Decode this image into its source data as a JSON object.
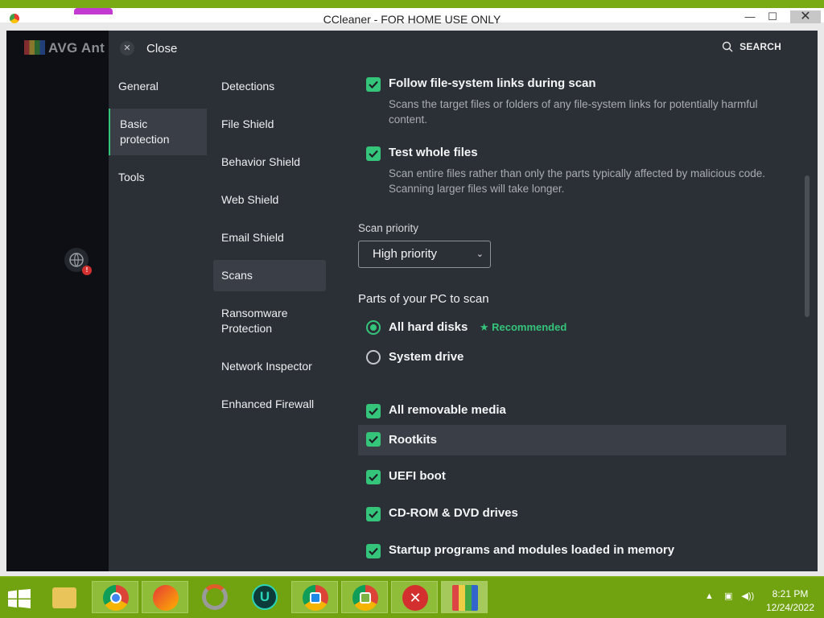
{
  "outer_window": {
    "title": "CCleaner - FOR HOME USE ONLY",
    "minimize_glyph": "—",
    "maximize_glyph": "☐",
    "close_glyph": "✕"
  },
  "avg": {
    "logo_text": "AVG Ant"
  },
  "header": {
    "close_label": "Close",
    "search_label": "SEARCH"
  },
  "nav_primary": [
    {
      "label": "General"
    },
    {
      "label": "Basic protection"
    },
    {
      "label": "Tools"
    }
  ],
  "nav_secondary": [
    {
      "label": "Detections"
    },
    {
      "label": "File Shield"
    },
    {
      "label": "Behavior Shield"
    },
    {
      "label": "Web Shield"
    },
    {
      "label": "Email Shield"
    },
    {
      "label": "Scans"
    },
    {
      "label": "Ransomware Protection"
    },
    {
      "label": "Network Inspector"
    },
    {
      "label": "Enhanced Firewall"
    }
  ],
  "options": {
    "follow_links": {
      "title": "Follow file-system links during scan",
      "desc": "Scans the target files or folders of any file-system links for potentially harmful content.",
      "checked": true
    },
    "test_whole_files": {
      "title": "Test whole files",
      "desc": "Scan entire files rather than only the parts typically affected by malicious code. Scanning larger files will take longer.",
      "checked": true
    }
  },
  "scan_priority": {
    "label": "Scan priority",
    "value": "High priority"
  },
  "parts_to_scan": {
    "title": "Parts of your PC to scan",
    "radio_all_disks": "All hard disks",
    "recommended": "★ Recommended",
    "radio_system_drive": "System drive",
    "selected": "All hard disks"
  },
  "scan_items": [
    {
      "label": "All removable media",
      "checked": true
    },
    {
      "label": "Rootkits",
      "checked": true
    },
    {
      "label": "UEFI boot",
      "checked": true
    },
    {
      "label": "CD-ROM & DVD drives",
      "checked": true
    },
    {
      "label": "Startup programs and modules loaded in memory",
      "checked": true
    }
  ],
  "taskbar": {
    "time": "8:21 PM",
    "date": "12/24/2022"
  },
  "colors": {
    "accent": "#34c47a",
    "panel_bg": "#2b2f36",
    "taskbar": "#70a30f"
  }
}
